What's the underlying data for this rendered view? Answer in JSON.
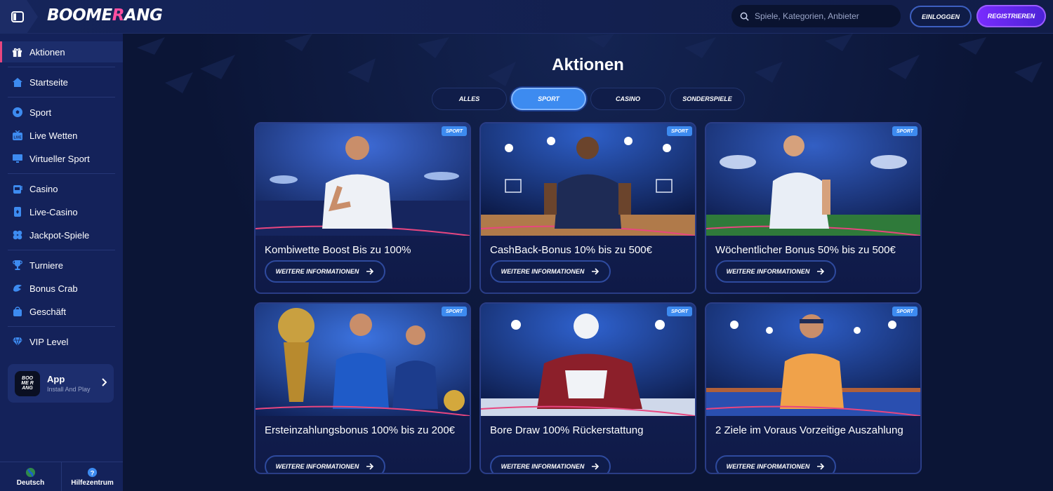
{
  "header": {
    "logo_main": "BOOME",
    "logo_accent": "R",
    "logo_end": "ANG",
    "search_placeholder": "Spiele, Kategorien, Anbieter",
    "login_label": "EINLOGGEN",
    "register_label": "REGISTRIEREN"
  },
  "sidebar": {
    "items": [
      {
        "label": "Aktionen",
        "icon": "gift-icon"
      },
      {
        "label": "Startseite",
        "icon": "home-icon"
      },
      {
        "label": "Sport",
        "icon": "soccer-ball-icon"
      },
      {
        "label": "Live Wetten",
        "icon": "live-tv-icon"
      },
      {
        "label": "Virtueller Sport",
        "icon": "monitor-icon"
      },
      {
        "label": "Casino",
        "icon": "slot-machine-icon"
      },
      {
        "label": "Live-Casino",
        "icon": "playing-card-icon"
      },
      {
        "label": "Jackpot-Spiele",
        "icon": "clover-icon"
      },
      {
        "label": "Turniere",
        "icon": "trophy-icon"
      },
      {
        "label": "Bonus Crab",
        "icon": "claw-icon"
      },
      {
        "label": "Geschäft",
        "icon": "shopping-bag-icon"
      },
      {
        "label": "VIP Level",
        "icon": "diamond-icon"
      }
    ],
    "app": {
      "logo_line1": "BOO",
      "logo_line2": "ME R",
      "logo_line3": "ANG",
      "title": "App",
      "subtitle": "Install And Play"
    },
    "footer": {
      "language": "Deutsch",
      "help": "Hilfezentrum"
    }
  },
  "main": {
    "title": "Aktionen",
    "tabs": [
      "ALLES",
      "SPORT",
      "CASINO",
      "SONDERSPIELE"
    ],
    "active_tab": "SPORT",
    "more_info_label": "WEITERE INFORMATIONEN",
    "cards": [
      {
        "badge": "SPORT",
        "title": "Kombiwette Boost Bis zu 100%"
      },
      {
        "badge": "SPORT",
        "title": "CashBack-Bonus 10% bis zu 500€"
      },
      {
        "badge": "SPORT",
        "title": "Wöchentlicher Bonus 50% bis zu 500€"
      },
      {
        "badge": "SPORT",
        "title": "Ersteinzahlungsbonus 100% bis zu 200€"
      },
      {
        "badge": "SPORT",
        "title": "Bore Draw 100% Rückerstattung"
      },
      {
        "badge": "SPORT",
        "title": "2 Ziele im Voraus Vorzeitige Auszahlung"
      }
    ]
  },
  "colors": {
    "accent_blue": "#3d8bf0",
    "accent_pink": "#e8467f",
    "register_purple": "#7a2cff",
    "background": "#0b1536",
    "sidebar": "#14225a"
  }
}
